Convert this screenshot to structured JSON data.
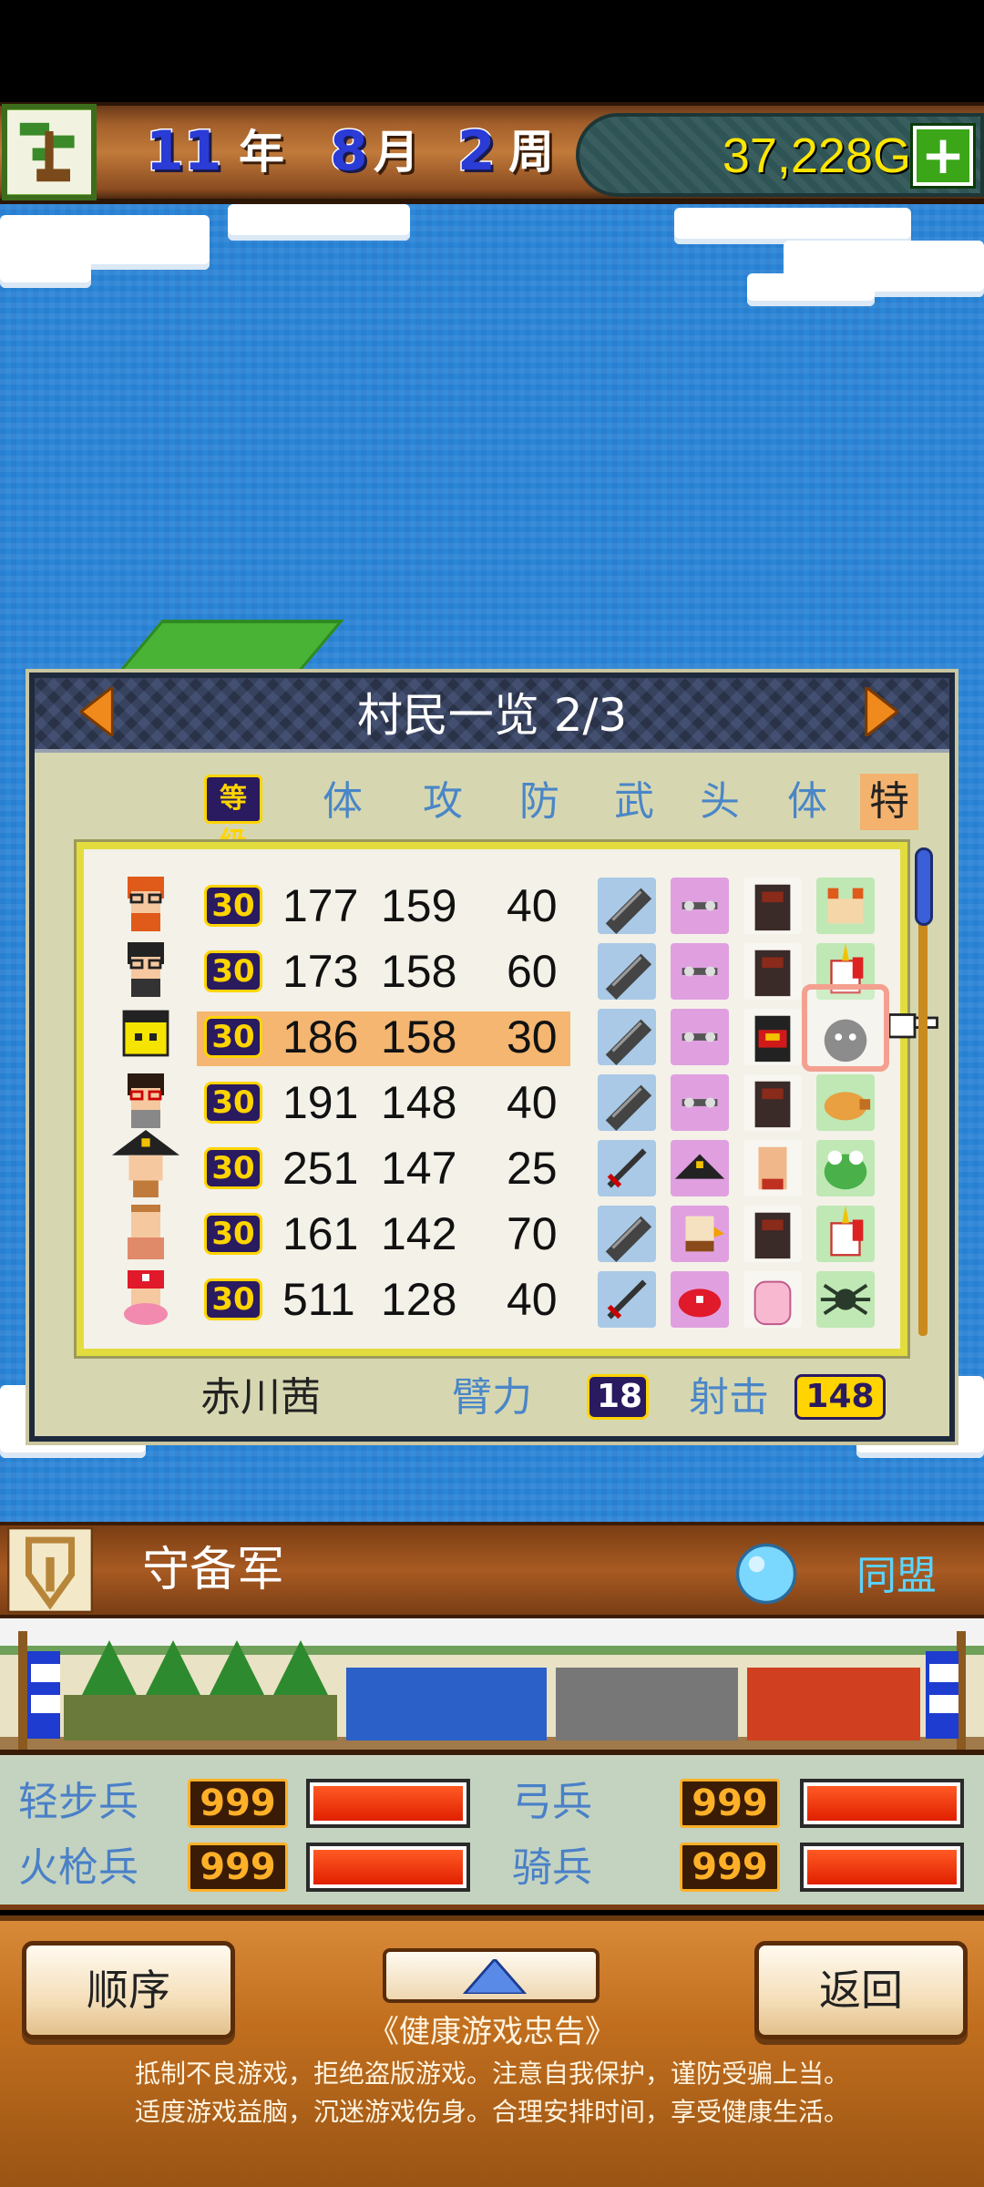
{
  "header": {
    "year_num": "11",
    "year_unit": "年",
    "month_num": "8",
    "month_unit": "月",
    "week_num": "2",
    "week_unit": "周",
    "gold": "37,228G",
    "add_icon": "plus-icon",
    "logo_icon": "bonsai-tree-icon"
  },
  "dialog": {
    "title": "村民一览 2/3",
    "prev_icon": "arrow-left-icon",
    "next_icon": "arrow-right-icon",
    "columns": {
      "level": "等级",
      "hp": "体",
      "attack": "攻",
      "defense": "防",
      "weapon": "武",
      "head": "头",
      "body": "体",
      "special": "特"
    },
    "rows": [
      {
        "avatar": "red-hair-glasses-villager-icon",
        "level": "30",
        "hp": "177",
        "atk": "159",
        "def": "40",
        "weapon": "gatling-gun-icon",
        "head": "goggles-icon",
        "body": "dark-armor-icon",
        "acc": "cat-pet-icon"
      },
      {
        "avatar": "black-hair-glasses-villager-icon",
        "level": "30",
        "hp": "173",
        "atk": "158",
        "def": "60",
        "weapon": "gatling-gun-icon",
        "head": "goggles-icon",
        "body": "dark-armor-icon",
        "acc": "unicorn-pet-icon"
      },
      {
        "avatar": "yellow-block-villager-icon",
        "level": "30",
        "hp": "186",
        "atk": "158",
        "def": "30",
        "weapon": "gatling-gun-icon",
        "head": "goggles-icon",
        "body": "red-armor-icon",
        "acc": "gray-cat-pet-icon",
        "selected": true
      },
      {
        "avatar": "glasses-girl-villager-icon",
        "level": "30",
        "hp": "191",
        "atk": "148",
        "def": "40",
        "weapon": "gatling-gun-icon",
        "head": "goggles-icon",
        "body": "dark-armor-icon",
        "acc": "pig-pet-icon"
      },
      {
        "avatar": "pirate-hat-villager-icon",
        "level": "30",
        "hp": "251",
        "atk": "147",
        "def": "25",
        "weapon": "sword-icon",
        "head": "pirate-hat-icon",
        "body": "bare-body-icon",
        "acc": "frog-pet-icon"
      },
      {
        "avatar": "bald-villager-icon",
        "level": "30",
        "hp": "161",
        "atk": "142",
        "def": "70",
        "weapon": "gatling-gun-icon",
        "head": "eagle-helmet-icon",
        "body": "dark-armor-icon",
        "acc": "unicorn-pet-icon"
      },
      {
        "avatar": "red-cap-pink-villager-icon",
        "level": "30",
        "hp": "511",
        "atk": "128",
        "def": "40",
        "weapon": "sword-icon",
        "head": "red-cap-icon",
        "body": "pink-suit-icon",
        "acc": "spider-pet-icon"
      }
    ],
    "selected_name": "赤川茜",
    "arm_label": "臂力",
    "arm_value": "18",
    "shoot_label": "射击",
    "shoot_value": "148"
  },
  "army": {
    "name": "守备军",
    "alliance": "同盟",
    "shield_icon": "shield-icon",
    "orb_icon": "blue-orb-icon",
    "troops": [
      {
        "label": "轻步兵",
        "count": "999",
        "fill": 1.0
      },
      {
        "label": "弓兵",
        "count": "999",
        "fill": 1.0
      },
      {
        "label": "火枪兵",
        "count": "999",
        "fill": 1.0
      },
      {
        "label": "骑兵",
        "count": "999",
        "fill": 1.0
      }
    ]
  },
  "footer": {
    "order_label": "顺序",
    "back_label": "返回",
    "up_icon": "triangle-up-icon",
    "notice_title": "《健康游戏忠告》",
    "notice_line1": "抵制不良游戏，拒绝盗版游戏。注意自我保护，谨防受骗上当。",
    "notice_line2": "适度游戏益脑，沉迷游戏伤身。合理安排时间，享受健康生活。"
  },
  "colors": {
    "gold": "#ffe600",
    "header_blue": "#4a86c8",
    "selected_row": "#f4b670",
    "level_badge": "#2a1a60"
  }
}
